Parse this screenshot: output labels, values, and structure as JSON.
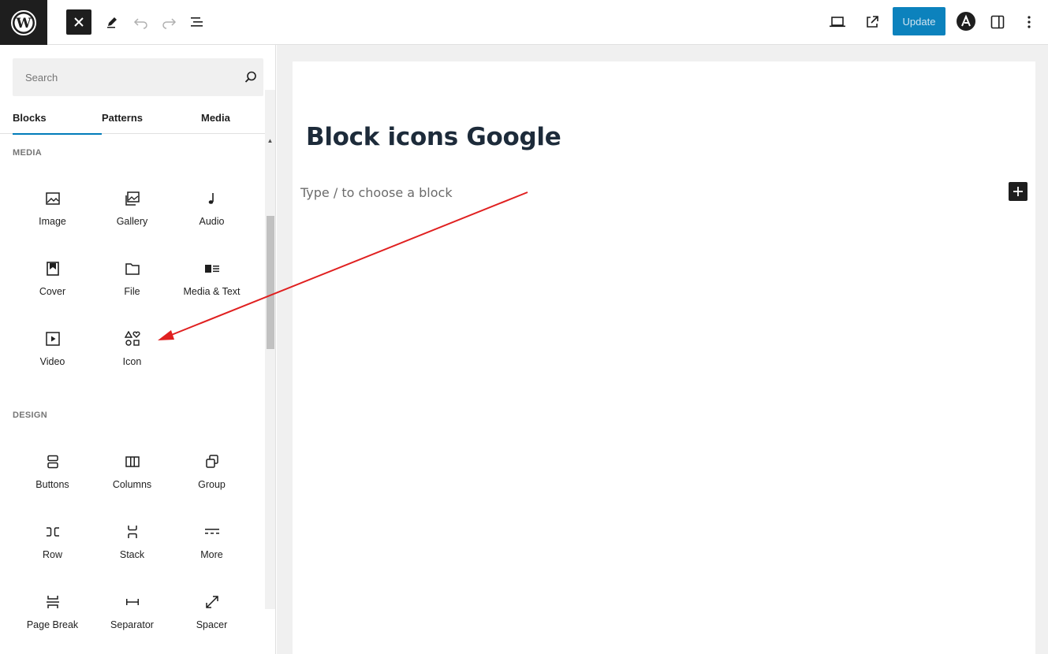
{
  "topbar": {
    "update_label": "Update"
  },
  "sidebar": {
    "search_placeholder": "Search",
    "tabs": [
      {
        "label": "Blocks"
      },
      {
        "label": "Patterns"
      },
      {
        "label": "Media"
      }
    ],
    "categories": [
      {
        "title": "MEDIA",
        "blocks": [
          {
            "label": "Image",
            "icon": "image-icon"
          },
          {
            "label": "Gallery",
            "icon": "gallery-icon"
          },
          {
            "label": "Audio",
            "icon": "audio-icon"
          },
          {
            "label": "Cover",
            "icon": "cover-icon"
          },
          {
            "label": "File",
            "icon": "file-icon"
          },
          {
            "label": "Media & Text",
            "icon": "media-text-icon"
          },
          {
            "label": "Video",
            "icon": "video-icon"
          },
          {
            "label": "Icon",
            "icon": "shapes-icon"
          }
        ]
      },
      {
        "title": "DESIGN",
        "blocks": [
          {
            "label": "Buttons",
            "icon": "buttons-icon"
          },
          {
            "label": "Columns",
            "icon": "columns-icon"
          },
          {
            "label": "Group",
            "icon": "group-icon"
          },
          {
            "label": "Row",
            "icon": "row-icon"
          },
          {
            "label": "Stack",
            "icon": "stack-icon"
          },
          {
            "label": "More",
            "icon": "more-icon"
          },
          {
            "label": "Page Break",
            "icon": "page-break-icon"
          },
          {
            "label": "Separator",
            "icon": "separator-icon"
          },
          {
            "label": "Spacer",
            "icon": "spacer-icon"
          }
        ]
      }
    ]
  },
  "editor": {
    "post_title": "Block icons Google",
    "block_placeholder": "Type / to choose a block"
  },
  "colors": {
    "accent": "#007cba",
    "dark": "#1e1e1e",
    "arrow": "#e02020"
  }
}
